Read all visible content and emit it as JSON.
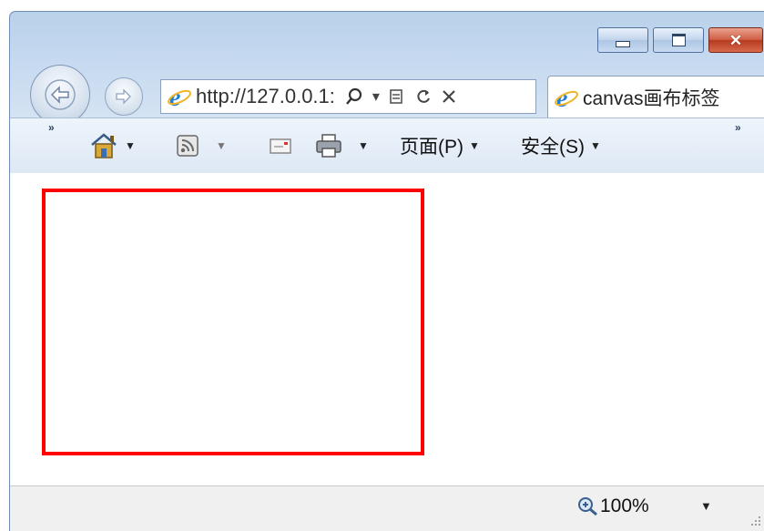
{
  "browser": {
    "address_url": "http://127.0.0.1:",
    "tab_title": "canvas画布标签"
  },
  "commandbar": {
    "chevron_left": "»",
    "chevron_right": "»",
    "page_menu": "页面(P)",
    "safety_menu": "安全(S)"
  },
  "status": {
    "zoom": "100%"
  },
  "canvas": {
    "border_color": "#ff0000"
  },
  "icons": {
    "close_glyph": "✕",
    "dropdown": "▼",
    "search_dropdown": "▾"
  }
}
